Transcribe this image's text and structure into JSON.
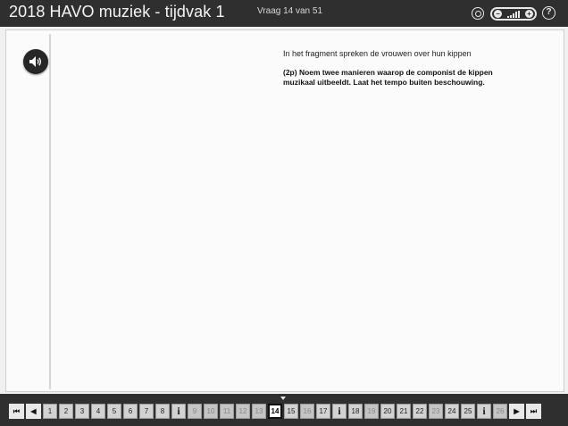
{
  "header": {
    "title": "2018 HAVO muziek - tijdvak 1",
    "question_counter": "Vraag 14 van 51",
    "settings_icon": "settings-icon",
    "volume_minus": "−",
    "volume_plus": "+",
    "help": "?"
  },
  "main": {
    "audio_icon": "speaker-icon",
    "intro": "In het fragment spreken de vrouwen over hun kippen",
    "question": "(2p) Noem twee manieren waarop de componist de kippen muzikaal uitbeeldt. Laat het tempo buiten beschouwing."
  },
  "navigation": {
    "first": "⏮",
    "prev": "◀",
    "next": "▶",
    "last": "⏭",
    "current": "14",
    "items": [
      "1",
      "2",
      "3",
      "4",
      "5",
      "6",
      "7",
      "8",
      "i",
      "9",
      "10",
      "11",
      "12",
      "13",
      "14",
      "15",
      "16",
      "17",
      "i",
      "18",
      "19",
      "20",
      "21",
      "22",
      "23",
      "24",
      "25",
      "i",
      "26"
    ],
    "dimmed": [
      "9",
      "10",
      "11",
      "12",
      "13",
      "16",
      "19",
      "23",
      "26"
    ]
  }
}
